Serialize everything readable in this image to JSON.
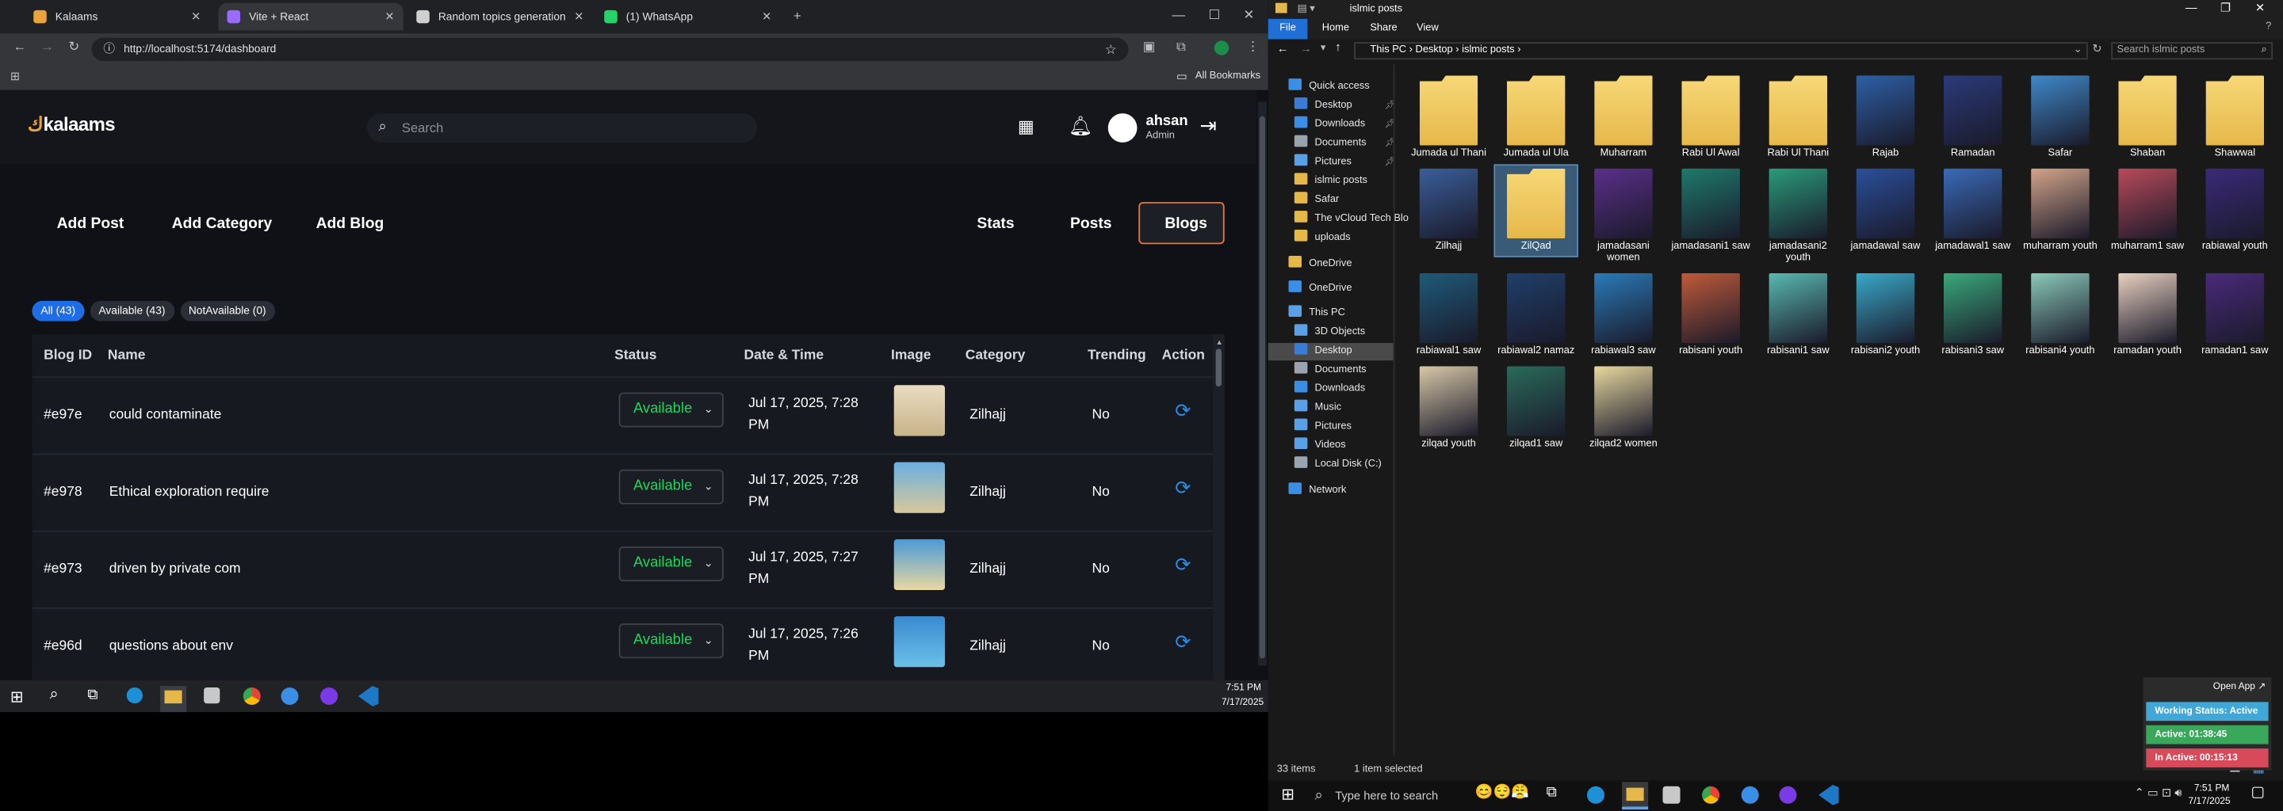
{
  "browser": {
    "tabs": [
      {
        "title": "Kalaams",
        "color": "#e8a33a"
      },
      {
        "title": "Vite + React",
        "color": "#9b6bff"
      },
      {
        "title": "Random topics generation",
        "color": "#cfcfcf"
      },
      {
        "title": "(1) WhatsApp",
        "color": "#25d366"
      }
    ],
    "url": "http://localhost:5174/dashboard",
    "bookmarks_label": "All Bookmarks"
  },
  "app": {
    "logo": "kalaams",
    "search_placeholder": "Search",
    "user": {
      "name": "ahsan",
      "role": "Admin"
    },
    "nav_left": [
      "Add Post",
      "Add Category",
      "Add Blog"
    ],
    "nav_right": [
      "Stats",
      "Posts",
      "Blogs"
    ],
    "filters": [
      "All (43)",
      "Available (43)",
      "NotAvailable (0)"
    ],
    "columns": [
      "Blog ID",
      "Name",
      "Status",
      "Date & Time",
      "Image",
      "Category",
      "Trending",
      "Action"
    ],
    "rows": [
      {
        "id": "#e97e",
        "name": "could contaminate",
        "status": "Available",
        "date1": "Jul 17, 2025, 7:28",
        "date2": "PM",
        "category": "Zilhajj",
        "trending": "No"
      },
      {
        "id": "#e978",
        "name": "Ethical exploration require",
        "status": "Available",
        "date1": "Jul 17, 2025, 7:28",
        "date2": "PM",
        "category": "Zilhajj",
        "trending": "No"
      },
      {
        "id": "#e973",
        "name": "driven by private com",
        "status": "Available",
        "date1": "Jul 17, 2025, 7:27",
        "date2": "PM",
        "category": "Zilhajj",
        "trending": "No"
      },
      {
        "id": "#e96d",
        "name": "questions about env",
        "status": "Available",
        "date1": "Jul 17, 2025, 7:26",
        "date2": "PM",
        "category": "Zilhajj",
        "trending": "No"
      }
    ]
  },
  "left_taskbar": {
    "time": "7:51 PM",
    "date": "7/17/2025"
  },
  "explorer": {
    "title": "islmic posts",
    "ribbon": [
      "File",
      "Home",
      "Share",
      "View"
    ],
    "breadcrumb": [
      "This PC",
      "Desktop",
      "islmic posts"
    ],
    "search_placeholder": "Search islmic posts",
    "nav": [
      {
        "label": "Quick access",
        "color": "#3a8ee6"
      },
      {
        "label": "Desktop",
        "color": "#3a7bd5"
      },
      {
        "label": "Downloads",
        "color": "#3a8ee6"
      },
      {
        "label": "Documents",
        "color": "#9aa4b0"
      },
      {
        "label": "Pictures",
        "color": "#5aa0e6"
      },
      {
        "label": "islmic posts",
        "color": "#e6b84a"
      },
      {
        "label": "Safar",
        "color": "#e6b84a"
      },
      {
        "label": "The vCloud Tech Blo",
        "color": "#e6b84a"
      },
      {
        "label": "uploads",
        "color": "#e6b84a"
      },
      {
        "label": "OneDrive",
        "color": "#e6b84a"
      },
      {
        "label": "OneDrive",
        "color": "#3a8ee6"
      },
      {
        "label": "This PC",
        "color": "#5aa0e6"
      },
      {
        "label": "3D Objects",
        "color": "#5aa0e6"
      },
      {
        "label": "Desktop",
        "color": "#3a7bd5"
      },
      {
        "label": "Documents",
        "color": "#9aa4b0"
      },
      {
        "label": "Downloads",
        "color": "#3a8ee6"
      },
      {
        "label": "Music",
        "color": "#5aa0e6"
      },
      {
        "label": "Pictures",
        "color": "#5aa0e6"
      },
      {
        "label": "Videos",
        "color": "#5aa0e6"
      },
      {
        "label": "Local Disk (C:)",
        "color": "#9aa4b0"
      },
      {
        "label": "Network",
        "color": "#3a8ee6"
      }
    ],
    "items": [
      {
        "label": "Jumada ul Thani",
        "kind": "folder"
      },
      {
        "label": "Jumada ul Ula",
        "kind": "folder"
      },
      {
        "label": "Muharram",
        "kind": "folder"
      },
      {
        "label": "Rabi Ul Awal",
        "kind": "folder"
      },
      {
        "label": "Rabi Ul Thani",
        "kind": "folder"
      },
      {
        "label": "Rajab",
        "kind": "image",
        "color": "#2d5fa6"
      },
      {
        "label": "Ramadan",
        "kind": "image",
        "color": "#2b3b7a"
      },
      {
        "label": "Safar",
        "kind": "image",
        "color": "#3f88c9"
      },
      {
        "label": "Shaban",
        "kind": "folder"
      },
      {
        "label": "Shawwal",
        "kind": "folder"
      },
      {
        "label": "Zilhajj",
        "kind": "image",
        "color": "#3a5e9a"
      },
      {
        "label": "ZilQad",
        "kind": "folder"
      },
      {
        "label": "jamadasani women",
        "kind": "image",
        "color": "#5a2f8a"
      },
      {
        "label": "jamadasani1 saw",
        "kind": "image",
        "color": "#1f7a6a"
      },
      {
        "label": "jamadasani2 youth",
        "kind": "image",
        "color": "#2a9a7a"
      },
      {
        "label": "jamadawal saw",
        "kind": "image",
        "color": "#2a4f9a"
      },
      {
        "label": "jamadawal1 saw",
        "kind": "image",
        "color": "#3a6ab8"
      },
      {
        "label": "muharram youth",
        "kind": "image",
        "color": "#d2a48a"
      },
      {
        "label": "muharram1 saw",
        "kind": "image",
        "color": "#b84a5a"
      },
      {
        "label": "rabiawal youth",
        "kind": "image",
        "color": "#3a2a7a"
      },
      {
        "label": "rabiawal1 saw",
        "kind": "image",
        "color": "#1f5a7a"
      },
      {
        "label": "rabiawal2 namaz",
        "kind": "image",
        "color": "#1f3f6a"
      },
      {
        "label": "rabiawal3 saw",
        "kind": "image",
        "color": "#2a7ab8"
      },
      {
        "label": "rabisani youth",
        "kind": "image",
        "color": "#c05a3a"
      },
      {
        "label": "rabisani1 saw",
        "kind": "image",
        "color": "#5ab8b0"
      },
      {
        "label": "rabisani2 youth",
        "kind": "image",
        "color": "#3aa8c8"
      },
      {
        "label": "rabisani3 saw",
        "kind": "image",
        "color": "#3aa87a"
      },
      {
        "label": "rabisani4 youth",
        "kind": "image",
        "color": "#8ac8b8"
      },
      {
        "label": "ramadan youth",
        "kind": "image",
        "color": "#e8d0c0"
      },
      {
        "label": "ramadan1 saw",
        "kind": "image",
        "color": "#4a2a7a"
      },
      {
        "label": "zilqad youth",
        "kind": "image",
        "color": "#d8c8a8"
      },
      {
        "label": "zilqad1 saw",
        "kind": "image",
        "color": "#2a6a5a"
      },
      {
        "label": "zilqad2 women",
        "kind": "image",
        "color": "#e8d8a0"
      }
    ],
    "status_count": "33 items",
    "status_selected": "1 item selected"
  },
  "right_taskbar": {
    "search_placeholder": "Type here to search",
    "time": "7:51 PM",
    "date": "7/17/2025"
  },
  "tracker": {
    "open_app": "Open App ↗",
    "working": "Working Status: Active",
    "active": "Active: 01:38:45",
    "inactive": "In Active: 00:15:13"
  }
}
